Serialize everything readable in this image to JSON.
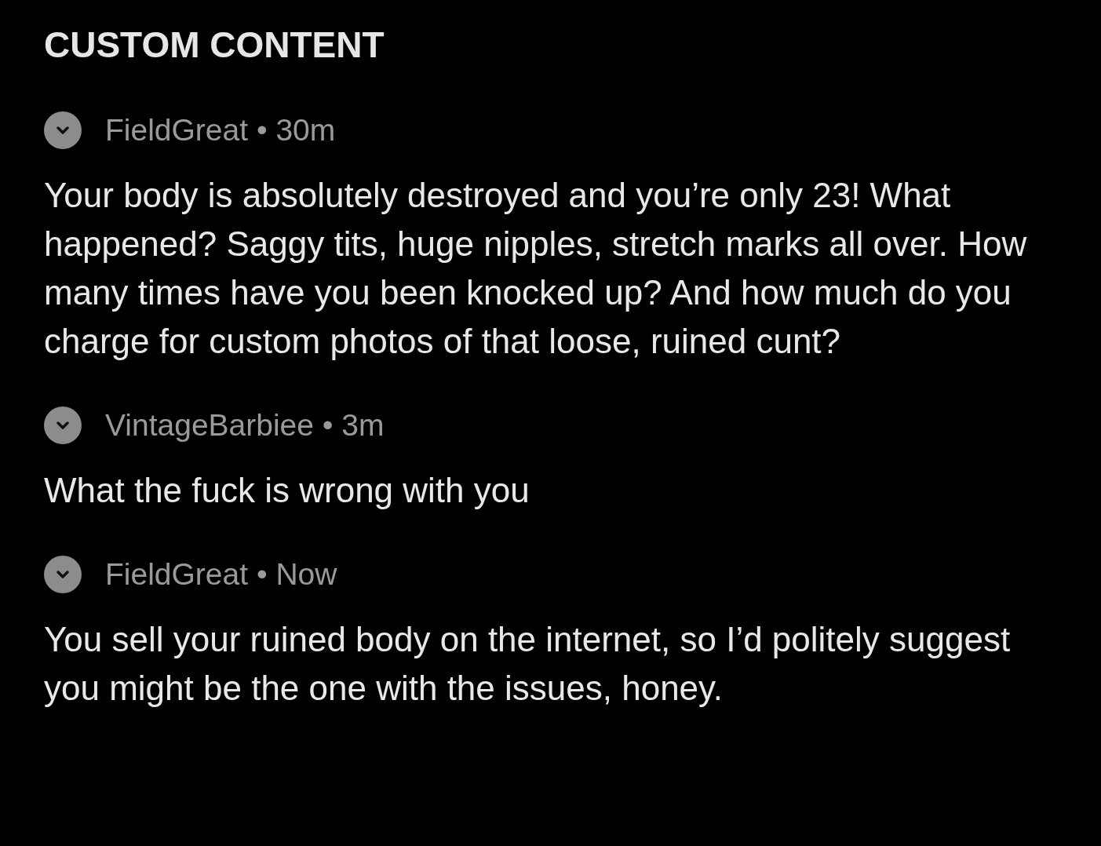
{
  "section_title": "CUSTOM CONTENT",
  "comments": [
    {
      "author": "FieldGreat",
      "separator": "•",
      "time": "30m",
      "text": "Your body is absolutely destroyed and you’re only 23! What happened? Saggy tits, huge nipples, stretch marks all over. How many times have you been knocked up? And how much do you charge for custom photos of that loose, ruined cunt?"
    },
    {
      "author": "VintageBarbiee",
      "separator": "•",
      "time": "3m",
      "text": "What the fuck is wrong with you"
    },
    {
      "author": "FieldGreat",
      "separator": "•",
      "time": "Now",
      "text": "You sell your ruined body on the internet, so I’d politely suggest you might be the one with the issues, honey."
    }
  ]
}
